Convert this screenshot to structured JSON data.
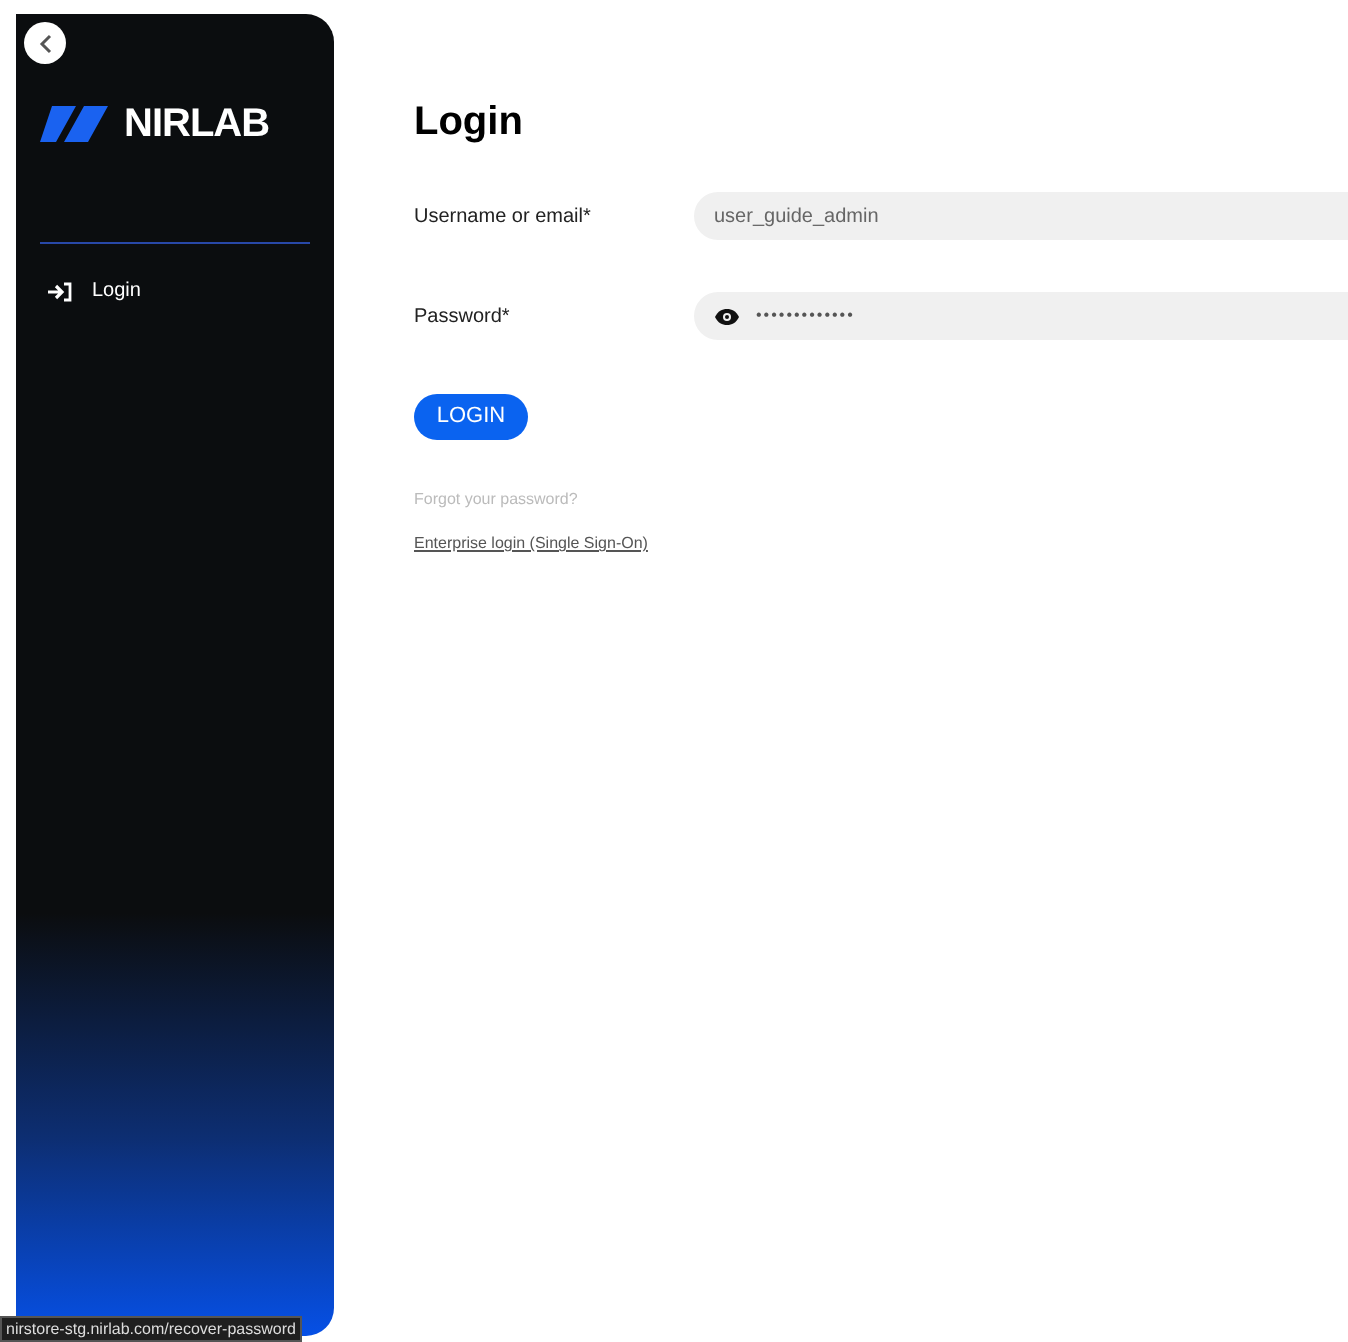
{
  "sidebar": {
    "logo_text": "NIRLAB",
    "items": [
      {
        "label": "Login",
        "selected": false
      }
    ]
  },
  "form": {
    "title": "Login",
    "fields": [
      {
        "kind": "text",
        "label": "Username or email*",
        "value": "user_guide_admin"
      },
      {
        "kind": "password",
        "label": "Password*",
        "value": "•••••••••••••"
      }
    ],
    "submit": "LOGIN",
    "links": [
      {
        "label": "Forgot your password?",
        "kind": "muted"
      },
      {
        "label": "Enterprise login (Single Sign-On)",
        "kind": "underlined"
      }
    ]
  },
  "status_bar": {
    "url": "nirstore-stg.nirlab.com/recover-password"
  }
}
